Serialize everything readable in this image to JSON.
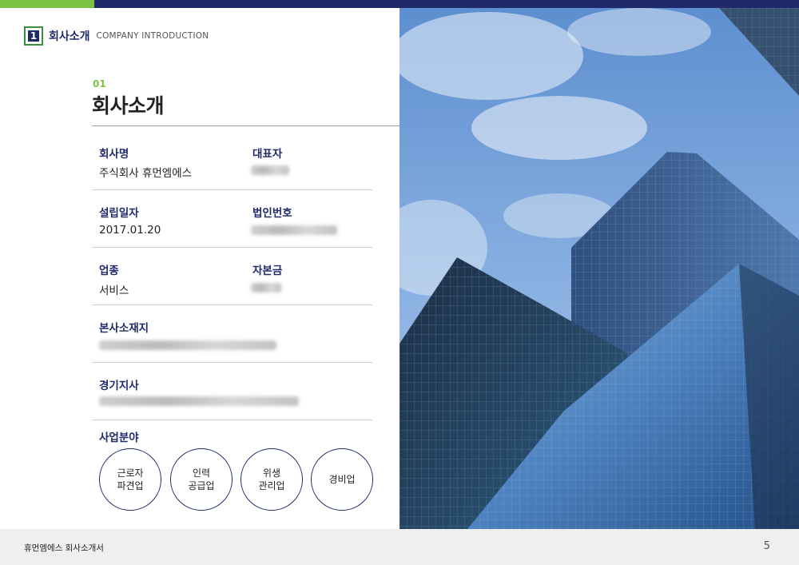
{
  "header": {
    "badge": "1",
    "title_ko": "회사소개",
    "title_en": "COMPANY INTRODUCTION"
  },
  "section": {
    "number": "01",
    "title": "회사소개"
  },
  "info": {
    "company_name_label": "회사명",
    "company_name_value": "주식회사 휴먼엠에스",
    "ceo_label": "대표자",
    "founded_label": "설립일자",
    "founded_value": "2017.01.20",
    "corp_no_label": "법인번호",
    "industry_label": "업종",
    "industry_value": "서비스",
    "capital_label": "자본금",
    "hq_label": "본사소재지",
    "branch_label": "경기지사"
  },
  "business": {
    "label": "사업분야",
    "items": [
      "근로자\n파견업",
      "인력\n공급업",
      "위생\n관리업",
      "경비업"
    ]
  },
  "footer": {
    "doc_title": "휴먼엠에스 회사소개서",
    "page": "5"
  },
  "colors": {
    "accent_green": "#7cc243",
    "navy": "#1f2a6b"
  },
  "image": {
    "subject": "glass office towers under a blue sky"
  }
}
